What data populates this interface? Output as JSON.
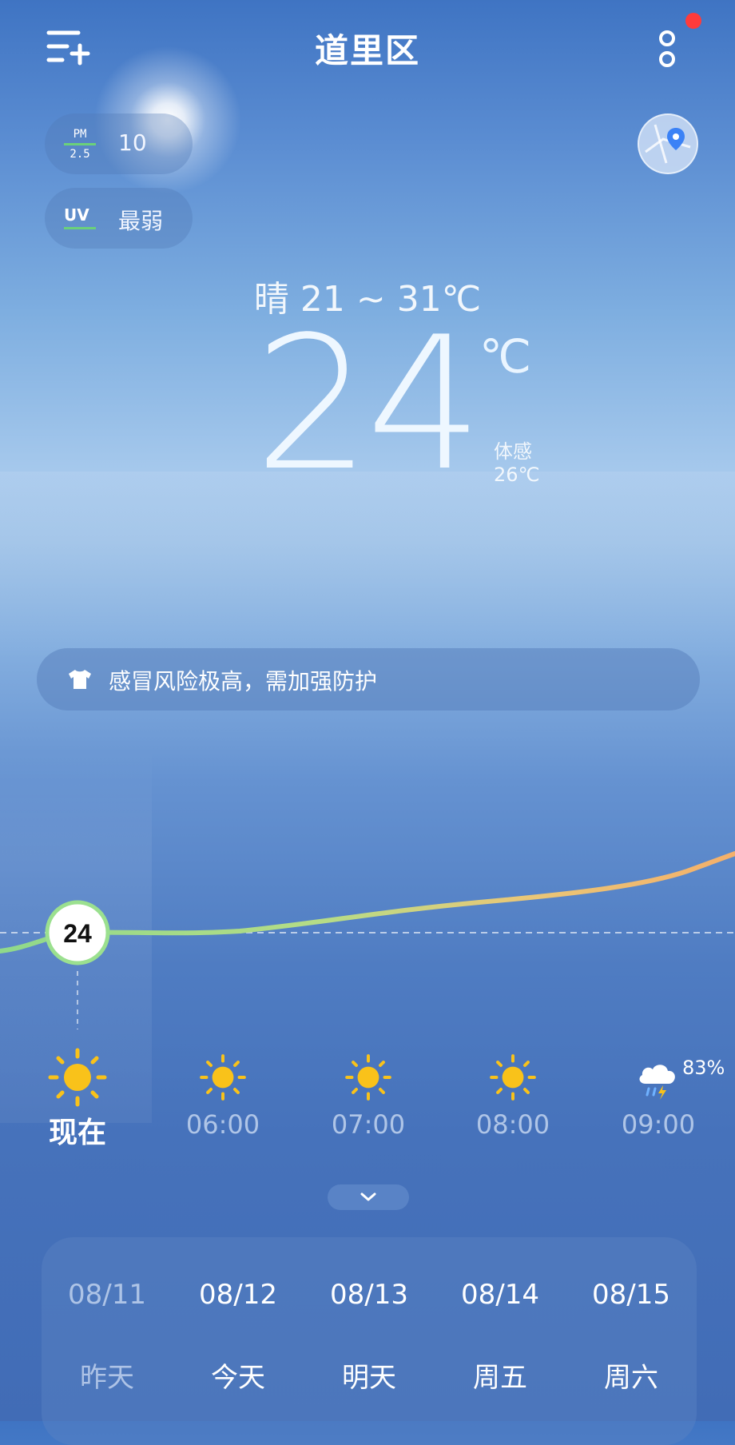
{
  "header": {
    "city": "道里区",
    "menu_icon": "add-city-menu-icon",
    "more_icon": "more-icon",
    "notification_dot": true
  },
  "air": {
    "pm_top": "PM",
    "pm_bottom": "2.5",
    "pm_value": "10",
    "uv_label": "UV",
    "uv_value": "最弱"
  },
  "current": {
    "condition_range": "晴  21 ~ 31℃",
    "temperature": "24",
    "unit": "℃",
    "feels_label": "体感",
    "feels_value": "26℃"
  },
  "notice": {
    "icon": "shirt-icon",
    "text": "感冒风险极高，需加强防护"
  },
  "hourly": {
    "current_temp_label": "24",
    "items": [
      {
        "time": "现在",
        "icon": "sun-icon",
        "now": true
      },
      {
        "time": "06:00",
        "icon": "sun-icon"
      },
      {
        "time": "07:00",
        "icon": "sun-icon"
      },
      {
        "time": "08:00",
        "icon": "sun-icon"
      },
      {
        "time": "09:00",
        "icon": "thunder-rain-icon",
        "precip": "83%"
      }
    ]
  },
  "daily": [
    {
      "date": "08/11",
      "name": "昨天",
      "past": true
    },
    {
      "date": "08/12",
      "name": "今天"
    },
    {
      "date": "08/13",
      "name": "明天"
    },
    {
      "date": "08/14",
      "name": "周五"
    },
    {
      "date": "08/15",
      "name": "周六"
    }
  ],
  "colors": {
    "accent_green": "#8fd98a",
    "accent_orange": "#f5b06a",
    "alert_dot": "#ff3b3b",
    "sun_yellow": "#f9c21a"
  }
}
